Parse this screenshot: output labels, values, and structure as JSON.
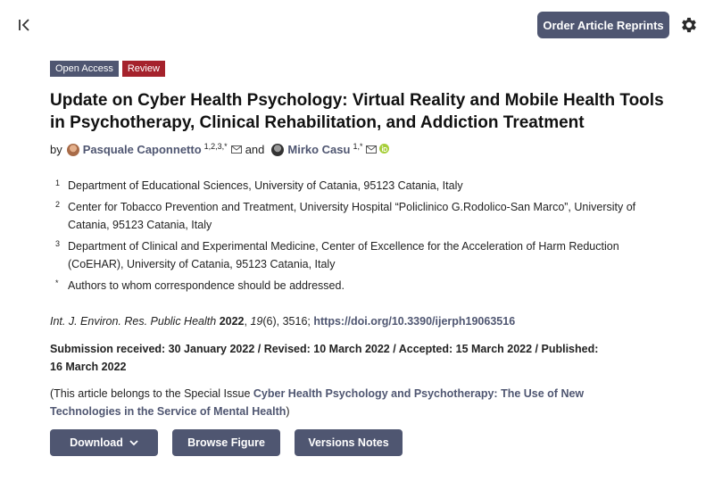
{
  "toolbar": {
    "collapse_icon": "collapse-left-icon",
    "reprints_label": "Order Article Reprints",
    "settings_icon": "gear-icon"
  },
  "badges": {
    "open_access": "Open Access",
    "review": "Review"
  },
  "article": {
    "title": "Update on Cyber Health Psychology: Virtual Reality and Mobile Health Tools in Psychotherapy, Clinical Rehabilitation, and Addiction Treatment",
    "by": "by",
    "and": "and",
    "authors": [
      {
        "name": "Pasquale Caponnetto",
        "sup": "1,2,3,*"
      },
      {
        "name": "Mirko Casu",
        "sup": "1,*"
      }
    ],
    "affiliations": [
      {
        "num": "1",
        "text": "Department of Educational Sciences, University of Catania, 95123 Catania, Italy"
      },
      {
        "num": "2",
        "text": "Center for Tobacco Prevention and Treatment, University Hospital “Policlinico G.Rodolico-San Marco”, University of Catania, 95123 Catania, Italy"
      },
      {
        "num": "3",
        "text": "Department of Clinical and Experimental Medicine, Center of Excellence for the Acceleration of Harm Reduction (CoEHAR), University of Catania, 95123 Catania, Italy"
      },
      {
        "num": "*",
        "text": "Authors to whom correspondence should be addressed."
      }
    ],
    "citation": {
      "journal": "Int. J. Environ. Res. Public Health",
      "year": "2022",
      "volume": "19",
      "issue_pages": "(6), 3516;",
      "doi": "https://doi.org/10.3390/ijerph19063516"
    },
    "dates": "Submission received: 30 January 2022 / Revised: 10 March 2022 / Accepted: 15 March 2022 / Published: 16 March 2022",
    "special_issue": {
      "prefix": "(This article belongs to the Special Issue",
      "link": "Cyber Health Psychology and Psychotherapy: The Use of New Technologies in the Service of Mental Health",
      "suffix": ")"
    }
  },
  "actions": {
    "download": "Download",
    "browse_figure": "Browse Figure",
    "versions_notes": "Versions Notes"
  },
  "colors": {
    "accent": "#4f5671",
    "review_badge": "#a5222c",
    "orcid": "#a6ce39"
  }
}
